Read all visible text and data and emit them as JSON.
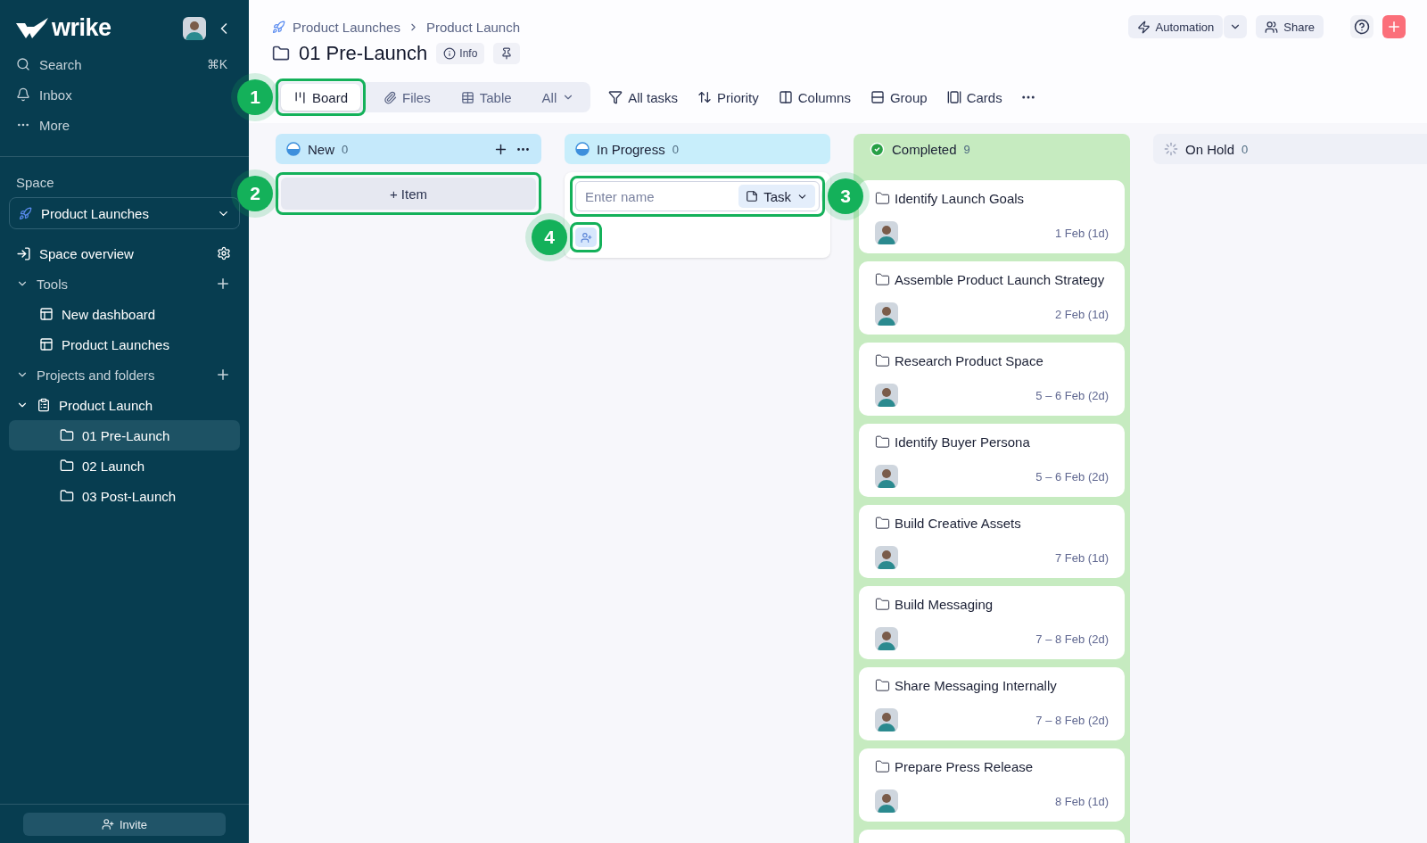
{
  "sidebar": {
    "logo": "wrike",
    "nav": [
      {
        "label": "Search",
        "kind": "search",
        "shortcut": "⌘K"
      },
      {
        "label": "Inbox",
        "kind": "inbox"
      },
      {
        "label": "More",
        "kind": "more"
      }
    ],
    "space_label": "Space",
    "space": "Product Launches",
    "space_overview": "Space overview",
    "tools": {
      "label": "Tools",
      "expanded": true,
      "items": [
        {
          "label": "New dashboard",
          "selected": false
        },
        {
          "label": "Product Launches",
          "selected": false
        }
      ]
    },
    "projects": {
      "label": "Projects and folders",
      "expanded": true,
      "items": [
        {
          "label": "Product Launch",
          "kind": "project",
          "expanded": true,
          "selected": false,
          "children": [
            {
              "label": "01 Pre-Launch",
              "kind": "folder",
              "selected": true
            },
            {
              "label": "02 Launch",
              "kind": "folder",
              "selected": false
            },
            {
              "label": "03 Post-Launch",
              "kind": "folder",
              "selected": false
            }
          ]
        }
      ]
    },
    "invite": "Invite"
  },
  "header": {
    "breadcrumb": [
      "Product Launches",
      "Product Launch"
    ],
    "title": "01 Pre-Launch",
    "info": "Info",
    "automation": "Automation",
    "share": "Share"
  },
  "views": [
    {
      "label": "Board",
      "kind": "board",
      "selected": true,
      "callout": "1"
    },
    {
      "label": "Files",
      "kind": "files",
      "selected": false
    },
    {
      "label": "Table",
      "kind": "table",
      "selected": false
    },
    {
      "label": "All",
      "kind": "dropdown",
      "selected": false
    }
  ],
  "toolbar": [
    {
      "label": "All tasks",
      "kind": "filter"
    },
    {
      "label": "Priority",
      "kind": "sort"
    },
    {
      "label": "Columns",
      "kind": "columns"
    },
    {
      "label": "Group",
      "kind": "group"
    },
    {
      "label": "Cards",
      "kind": "cards"
    }
  ],
  "columns": [
    {
      "name": "New",
      "count": "0",
      "kind": "new",
      "color": "#c5e9fb",
      "add_item": {
        "label": "+ Item",
        "callout": "2"
      }
    },
    {
      "name": "In Progress",
      "count": "0",
      "kind": "new",
      "color": "#c8eefb",
      "new_task": {
        "placeholder": "Enter name",
        "type": "Task",
        "callout": "3",
        "assign_callout": "4"
      }
    },
    {
      "name": "Completed",
      "count": "9",
      "kind": "completed",
      "color": "#c6ebc0",
      "more_cards_below": true,
      "cards": [
        {
          "title": "Identify Launch Goals",
          "date": "1 Feb (1d)"
        },
        {
          "title": "Assemble Product Launch Strategy",
          "date": "2 Feb (1d)"
        },
        {
          "title": "Research Product Space",
          "date": "5 – 6 Feb (2d)"
        },
        {
          "title": "Identify Buyer Persona",
          "date": "5 – 6 Feb (2d)"
        },
        {
          "title": "Build Creative Assets",
          "date": "7 Feb (1d)"
        },
        {
          "title": "Build Messaging",
          "date": "7 – 8 Feb (2d)"
        },
        {
          "title": "Share Messaging Internally",
          "date": "7 – 8 Feb (2d)"
        },
        {
          "title": "Prepare Press Release",
          "date": "8 Feb (1d)"
        }
      ]
    },
    {
      "name": "On Hold",
      "count": "0",
      "kind": "on_hold",
      "color": "#eef0f7"
    }
  ]
}
